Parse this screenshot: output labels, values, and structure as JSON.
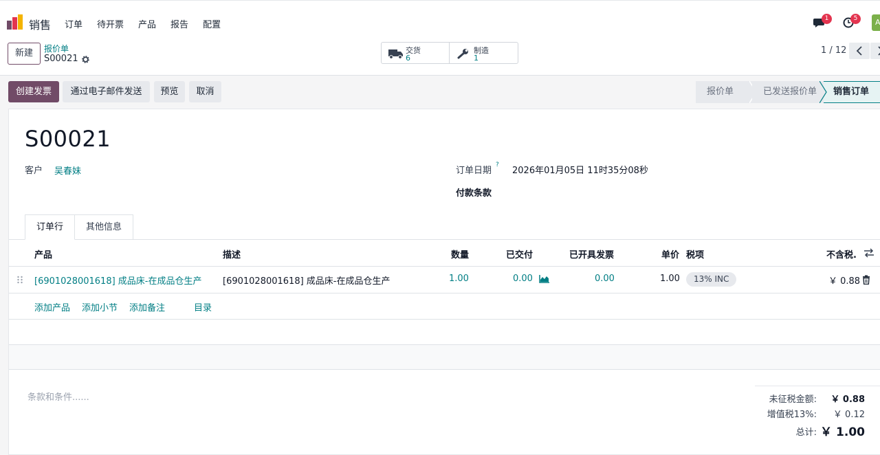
{
  "navbar": {
    "app_name": "销售",
    "menu": [
      "订单",
      "待开票",
      "产品",
      "报告",
      "配置"
    ],
    "messages_count": "1",
    "activities_count": "5",
    "avatar_initial": "A",
    "brand_colors": [
      "#f4b400",
      "#e3344f",
      "#714b67"
    ]
  },
  "control_panel": {
    "new_label": "新建",
    "breadcrumb_parent": "报价单",
    "breadcrumb_current": "S00021",
    "smart_buttons": [
      {
        "icon": "truck-icon",
        "label": "交货",
        "value": "6"
      },
      {
        "icon": "wrench-icon",
        "label": "制造",
        "value": "1"
      }
    ],
    "pager": "1 / 12"
  },
  "actions": {
    "create_invoice": "创建发票",
    "send_email": "通过电子邮件发送",
    "preview": "预览",
    "cancel": "取消"
  },
  "statusbar": {
    "stages": [
      "报价单",
      "已发送报价单",
      "销售订单"
    ],
    "active_stage": "销售订单"
  },
  "form": {
    "name": "S00021",
    "customer_label": "客户",
    "customer_value": "吴春妹",
    "order_date_label": "订单日期",
    "order_date_help": "?",
    "order_date_value": "2026年01月05日 11时35分08秒",
    "payment_terms_label": "付款条款",
    "tabs": [
      "订单行",
      "其他信息"
    ]
  },
  "order_lines": {
    "headers": {
      "product": "产品",
      "description": "描述",
      "quantity": "数量",
      "delivered": "已交付",
      "invoiced": "已开具发票",
      "unit_price": "单价",
      "taxes": "税项",
      "subtotal": "不含税."
    },
    "rows": [
      {
        "product": "[6901028001618] 成品床-在成品仓生产",
        "description": "[6901028001618] 成品床-在成品仓生产",
        "quantity": "1.00",
        "delivered": "0.00",
        "invoiced": "0.00",
        "unit_price": "1.00",
        "tax": "13% INC",
        "subtotal": "￥ 0.88"
      }
    ],
    "add_links": [
      "添加产品",
      "添加小节",
      "添加备注",
      "目录"
    ]
  },
  "footer": {
    "terms_placeholder": "条款和条件......",
    "untaxed_label": "未征税金额:",
    "untaxed_value": "￥ 0.88",
    "vat_label": "增值税13%:",
    "vat_value": "￥ 0.12",
    "total_label": "总计:",
    "total_value": "￥ 1.00"
  }
}
